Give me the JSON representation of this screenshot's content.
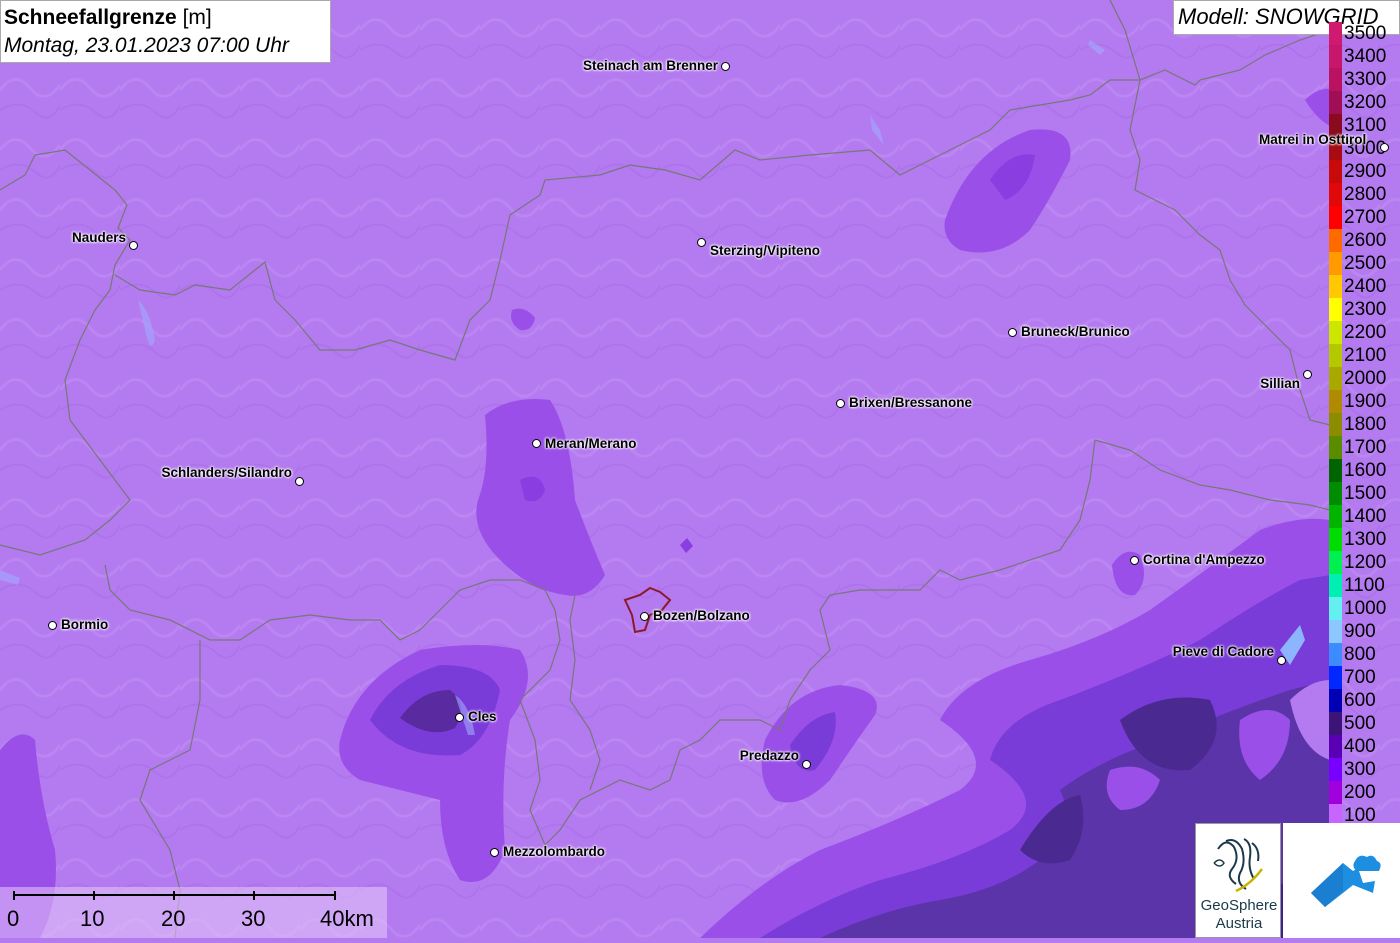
{
  "header": {
    "title_bold": "Schneefallgrenze",
    "title_unit": "[m]",
    "subtitle": "Montag, 23.01.2023 07:00 Uhr"
  },
  "model_label": "Modell: SNOWGRID",
  "legend": {
    "items": [
      {
        "value": "3500",
        "color": "#d01a70"
      },
      {
        "value": "3400",
        "color": "#c8176a"
      },
      {
        "value": "3300",
        "color": "#b81260"
      },
      {
        "value": "3200",
        "color": "#a00f55"
      },
      {
        "value": "3100",
        "color": "#8b0a1e"
      },
      {
        "value": "3000",
        "color": "#a80c12"
      },
      {
        "value": "2900",
        "color": "#c80a0a"
      },
      {
        "value": "2800",
        "color": "#e00808"
      },
      {
        "value": "2700",
        "color": "#ff0000"
      },
      {
        "value": "2600",
        "color": "#ff6a00"
      },
      {
        "value": "2500",
        "color": "#ff9a00"
      },
      {
        "value": "2400",
        "color": "#ffc800"
      },
      {
        "value": "2300",
        "color": "#ffff00"
      },
      {
        "value": "2200",
        "color": "#cce600"
      },
      {
        "value": "2100",
        "color": "#b4c800"
      },
      {
        "value": "2000",
        "color": "#a8a800"
      },
      {
        "value": "1900",
        "color": "#b08a00"
      },
      {
        "value": "1800",
        "color": "#8c8c00"
      },
      {
        "value": "1700",
        "color": "#5a8c00"
      },
      {
        "value": "1600",
        "color": "#006400"
      },
      {
        "value": "1500",
        "color": "#008c00"
      },
      {
        "value": "1400",
        "color": "#00b400"
      },
      {
        "value": "1300",
        "color": "#00dc00"
      },
      {
        "value": "1200",
        "color": "#00f050"
      },
      {
        "value": "1100",
        "color": "#00f0b4"
      },
      {
        "value": "1000",
        "color": "#64f0f0"
      },
      {
        "value": "900",
        "color": "#8cc8ff"
      },
      {
        "value": "800",
        "color": "#3c8cff"
      },
      {
        "value": "700",
        "color": "#0028ff"
      },
      {
        "value": "600",
        "color": "#0000b4"
      },
      {
        "value": "500",
        "color": "#3c1478"
      },
      {
        "value": "400",
        "color": "#5a00b4"
      },
      {
        "value": "300",
        "color": "#7800ff"
      },
      {
        "value": "200",
        "color": "#a000dc"
      },
      {
        "value": "100",
        "color": "#c864ff"
      }
    ]
  },
  "cities": [
    {
      "name": "Steinach am Brenner",
      "label_side": "left"
    },
    {
      "name": "Nauders",
      "label_side": "left"
    },
    {
      "name": "Sterzing/Vipiteno",
      "label_side": "right"
    },
    {
      "name": "Bruneck/Brunico",
      "label_side": "right"
    },
    {
      "name": "Matrei in Osttirol",
      "label_side": "left"
    },
    {
      "name": "Sillian",
      "label_side": "left"
    },
    {
      "name": "Brixen/Bressanone",
      "label_side": "right"
    },
    {
      "name": "Meran/Merano",
      "label_side": "right"
    },
    {
      "name": "Schlanders/Silandro",
      "label_side": "left"
    },
    {
      "name": "Cortina d'Ampezzo",
      "label_side": "right"
    },
    {
      "name": "Bormio",
      "label_side": "right"
    },
    {
      "name": "Bozen/Bolzano",
      "label_side": "right"
    },
    {
      "name": "Pieve di Cadore",
      "label_side": "left"
    },
    {
      "name": "Cles",
      "label_side": "right"
    },
    {
      "name": "Predazzo",
      "label_side": "left"
    },
    {
      "name": "Mezzolombardo",
      "label_side": "right"
    }
  ],
  "scale_bar": {
    "labels": [
      "0",
      "10",
      "20",
      "30",
      "40km"
    ]
  },
  "logos": {
    "geosphere_line1": "GeoSphere",
    "geosphere_line2": "Austria"
  },
  "colors": {
    "background": "#b47af0",
    "snowline_low": "#8a3de0",
    "snowline_lower": "#6a28c8",
    "snowline_dark": "#4a2a90",
    "border": "#777777"
  }
}
